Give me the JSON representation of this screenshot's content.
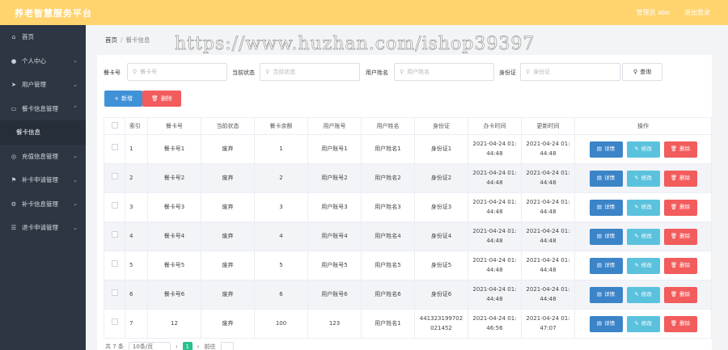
{
  "app": {
    "title": "养老智慧服务平台",
    "admin_label": "管理员 abo",
    "logout_label": "退出登录"
  },
  "sidebar": {
    "items": [
      {
        "label": "首页",
        "icon": "home-icon",
        "glyph": "⌂",
        "chevron": ""
      },
      {
        "label": "个人中心",
        "icon": "user-icon",
        "glyph": "●",
        "chevron": "⌄"
      },
      {
        "label": "用户管理",
        "icon": "send-icon",
        "glyph": "➤",
        "chevron": "⌄"
      },
      {
        "label": "餐卡信息管理",
        "icon": "card-icon",
        "glyph": "▭",
        "chevron": "⌃"
      },
      {
        "label": "餐卡信息",
        "icon": "",
        "glyph": "",
        "chevron": ""
      },
      {
        "label": "充值信息管理",
        "icon": "compass-icon",
        "glyph": "◎",
        "chevron": "⌄"
      },
      {
        "label": "补卡申请管理",
        "icon": "flag-icon",
        "glyph": "⚑",
        "chevron": "⌄"
      },
      {
        "label": "补卡信息管理",
        "icon": "gear-icon",
        "glyph": "⚙",
        "chevron": "⌄"
      },
      {
        "label": "退卡申请管理",
        "icon": "sliders-icon",
        "glyph": "☰",
        "chevron": "⌄"
      }
    ]
  },
  "breadcrumb": {
    "home": "首页",
    "separator": "/",
    "current": "餐卡信息"
  },
  "watermark": "https://www.huzhan.com/ishop39397",
  "filters": [
    {
      "label": "餐卡号",
      "placeholder": "餐卡号"
    },
    {
      "label": "当前状态",
      "placeholder": "当前状态"
    },
    {
      "label": "用户姓名",
      "placeholder": "用户姓名"
    },
    {
      "label": "身份证",
      "placeholder": "身份证"
    }
  ],
  "search_button": "查询",
  "actions": {
    "add": "新增",
    "delete": "删除"
  },
  "table": {
    "columns": [
      "索引",
      "餐卡号",
      "当前状态",
      "餐卡余额",
      "用户账号",
      "用户姓名",
      "身份证",
      "办卡时间",
      "更新时间",
      "操作"
    ],
    "rows": [
      {
        "idx": "1",
        "card": "餐卡号1",
        "status": "废弃",
        "balance": "1",
        "account": "用户账号1",
        "name": "用户姓名1",
        "id": [
          "身份证1"
        ],
        "created": [
          "2021-04-24 01:",
          "44:48"
        ],
        "updated": [
          "2021-04-24 01:",
          "44:48"
        ]
      },
      {
        "idx": "2",
        "card": "餐卡号2",
        "status": "废弃",
        "balance": "2",
        "account": "用户账号2",
        "name": "用户姓名2",
        "id": [
          "身份证2"
        ],
        "created": [
          "2021-04-24 01:",
          "44:48"
        ],
        "updated": [
          "2021-04-24 01:",
          "44:48"
        ]
      },
      {
        "idx": "3",
        "card": "餐卡号3",
        "status": "废弃",
        "balance": "3",
        "account": "用户账号3",
        "name": "用户姓名3",
        "id": [
          "身份证3"
        ],
        "created": [
          "2021-04-24 01:",
          "44:48"
        ],
        "updated": [
          "2021-04-24 01:",
          "44:48"
        ]
      },
      {
        "idx": "4",
        "card": "餐卡号4",
        "status": "废弃",
        "balance": "4",
        "account": "用户账号4",
        "name": "用户姓名4",
        "id": [
          "身份证4"
        ],
        "created": [
          "2021-04-24 01:",
          "44:48"
        ],
        "updated": [
          "2021-04-24 01:",
          "44:48"
        ]
      },
      {
        "idx": "5",
        "card": "餐卡号5",
        "status": "废弃",
        "balance": "5",
        "account": "用户账号5",
        "name": "用户姓名5",
        "id": [
          "身份证5"
        ],
        "created": [
          "2021-04-24 01:",
          "44:48"
        ],
        "updated": [
          "2021-04-24 01:",
          "44:48"
        ]
      },
      {
        "idx": "6",
        "card": "餐卡号6",
        "status": "废弃",
        "balance": "6",
        "account": "用户账号6",
        "name": "用户姓名6",
        "id": [
          "身份证6"
        ],
        "created": [
          "2021-04-24 01:",
          "44:48"
        ],
        "updated": [
          "2021-04-24 01:",
          "44:48"
        ]
      },
      {
        "idx": "7",
        "card": "12",
        "status": "废弃",
        "balance": "100",
        "account": "123",
        "name": "用户姓名1",
        "id": [
          "441323199702",
          "021452"
        ],
        "created": [
          "2021-04-24 01:",
          "46:56"
        ],
        "updated": [
          "2021-04-24 01:",
          "47:07"
        ]
      }
    ],
    "row_actions": {
      "detail": "详情",
      "edit": "修改",
      "delete": "删除"
    }
  },
  "pager": {
    "total": "共 7 条",
    "page_size": "10条/页",
    "current_page": "1",
    "goto": "前往"
  },
  "colors": {
    "header": "#ffd36e",
    "sidebar": "#2d3643",
    "primary": "#4092d8",
    "danger": "#f25c5c",
    "info": "#5bc2de",
    "pager_active": "#27c08e"
  }
}
